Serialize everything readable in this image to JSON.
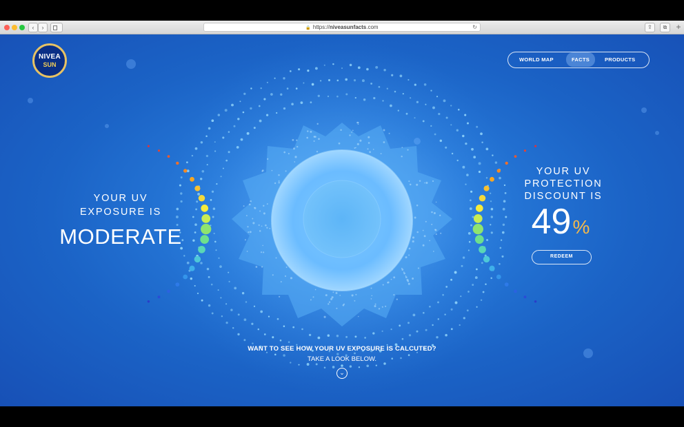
{
  "browser": {
    "url_prefix": "https://",
    "url_domain": "niveasunfacts",
    "url_tld": ".com",
    "back_glyph": "‹",
    "forward_glyph": "›",
    "reload_glyph": "↻",
    "share_glyph": "⇪",
    "tabs_glyph": "⧉",
    "newtab_glyph": "+"
  },
  "logo": {
    "top": "NIVEA",
    "bottom": "SUN"
  },
  "nav": {
    "world_map": "WORLD MAP",
    "facts": "FACTS",
    "products": "PRODUCTS",
    "active": "FACTS"
  },
  "exposure": {
    "title": "YOUR UV EXPOSURE IS",
    "level": "MODERATE"
  },
  "discount": {
    "title": "YOUR UV PROTECTION DISCOUNT IS",
    "value": "49",
    "unit": "%",
    "redeem": "REDEEM"
  },
  "cta": {
    "question": "WANT TO SEE HOW YOUR UV EXPOSURE IS CALCUTED?",
    "sub": "TAKE A LOOK BELOW.",
    "scroll_glyph": "⌄"
  },
  "colors": {
    "accent_gold": "#f4b94a",
    "page_blue": "#2678d8",
    "logo_navy": "#0a2f86"
  },
  "icons": [
    "lock-icon",
    "reload-icon",
    "share-icon",
    "tabs-icon",
    "chevron-down-icon"
  ]
}
